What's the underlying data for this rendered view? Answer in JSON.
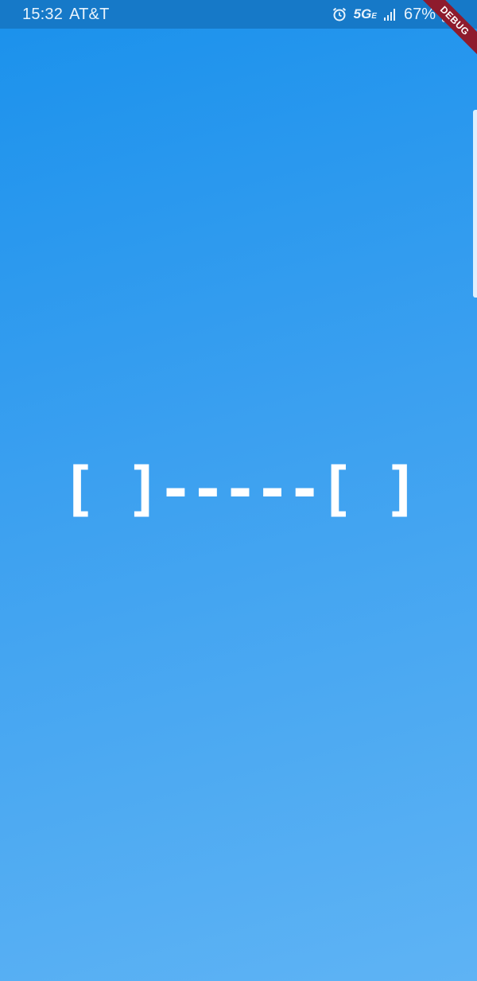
{
  "status_bar": {
    "time": "15:32",
    "carrier": "AT&T",
    "network": "5G",
    "network_suffix": "E",
    "battery": "67%",
    "icons": [
      "alarm-icon",
      "signal-icon",
      "battery-icon"
    ],
    "background_color": "#1679c8"
  },
  "debug_banner": {
    "label": "DEBUG",
    "color": "#8e1b2d"
  },
  "loader": {
    "text": "[ ]-----[ ]"
  },
  "theme": {
    "gradient_start": "#1a91ec",
    "gradient_end": "#5eb3f4",
    "text_color": "#ffffff"
  }
}
